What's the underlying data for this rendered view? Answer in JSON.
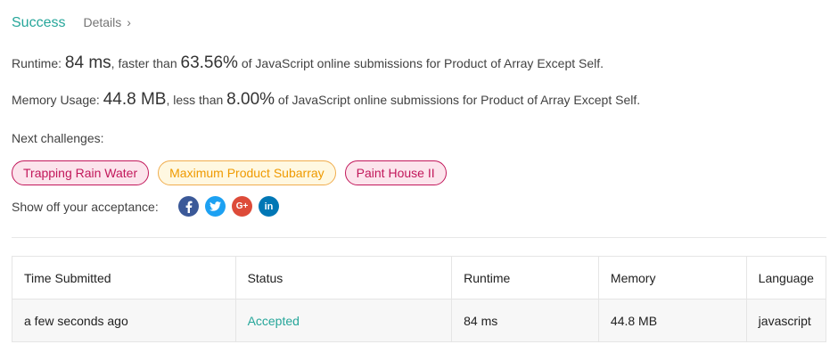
{
  "header": {
    "status": "Success",
    "details_label": "Details",
    "details_chevron": "›"
  },
  "runtime": {
    "label": "Runtime: ",
    "value": "84 ms",
    "compare_text": ", faster than ",
    "percent": "63.56%",
    "suffix": " of JavaScript online submissions for Product of Array Except Self."
  },
  "memory": {
    "label": "Memory Usage: ",
    "value": "44.8 MB",
    "compare_text": ", less than ",
    "percent": "8.00%",
    "suffix": " of JavaScript online submissions for Product of Array Except Self."
  },
  "next": {
    "label": "Next challenges:",
    "challenges": [
      {
        "title": "Trapping Rain Water",
        "difficulty": "hard",
        "color": "#c2185b"
      },
      {
        "title": "Maximum Product Subarray",
        "difficulty": "medium",
        "color": "#ef9a00"
      },
      {
        "title": "Paint House II",
        "difficulty": "hard",
        "color": "#c2185b"
      }
    ]
  },
  "share": {
    "label": "Show off your acceptance:",
    "icons": [
      {
        "name": "facebook-icon",
        "glyph": "f",
        "color": "#3b5998"
      },
      {
        "name": "twitter-icon",
        "glyph": "t",
        "color": "#1da1f2"
      },
      {
        "name": "google-plus-icon",
        "glyph": "G+",
        "color": "#dd4b39"
      },
      {
        "name": "linkedin-icon",
        "glyph": "in",
        "color": "#0077b5"
      }
    ]
  },
  "table": {
    "headers": [
      "Time Submitted",
      "Status",
      "Runtime",
      "Memory",
      "Language"
    ],
    "rows": [
      [
        "a few seconds ago",
        "Accepted",
        "84 ms",
        "44.8 MB",
        "javascript"
      ]
    ]
  },
  "colors": {
    "accent": "#26a69a",
    "hard": "#c2185b",
    "medium": "#ef9a00"
  }
}
